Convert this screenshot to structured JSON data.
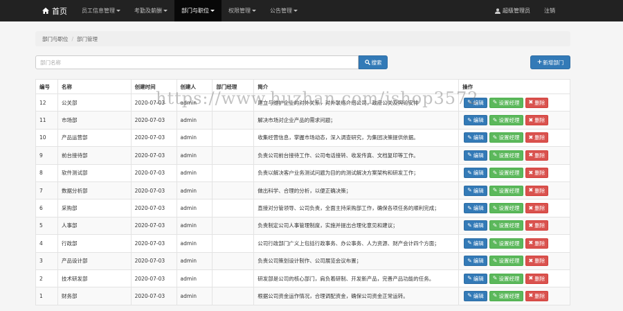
{
  "nav": {
    "brand": "首页",
    "items": [
      {
        "label": "员工信息管理",
        "active": false
      },
      {
        "label": "考勤及薪酬",
        "active": false
      },
      {
        "label": "部门与职位",
        "active": true
      },
      {
        "label": "权限管理",
        "active": false
      },
      {
        "label": "公告管理",
        "active": false
      }
    ],
    "user": "超级管理员",
    "logout": "注销"
  },
  "breadcrumb": {
    "parent": "部门与职位",
    "current": "部门管理"
  },
  "search": {
    "placeholder": "部门名称",
    "value": "",
    "button": "搜索"
  },
  "add_button": "新增部门",
  "table": {
    "headers": [
      "编号",
      "名称",
      "创建时间",
      "创建人",
      "部门经理",
      "简介",
      "操作"
    ],
    "rows": [
      {
        "id": "12",
        "name": "公关部",
        "date": "2020-07-03",
        "creator": "admin",
        "manager": "",
        "desc": "建立与维护企业的对外关系，对外联络介绍公司，政府公关及舆论安排"
      },
      {
        "id": "11",
        "name": "市场部",
        "date": "2020-07-03",
        "creator": "admin",
        "manager": "",
        "desc": "解决市场对企业产品的需求问题；"
      },
      {
        "id": "10",
        "name": "产品运营部",
        "date": "2020-07-03",
        "creator": "admin",
        "manager": "",
        "desc": "收集经营信息，掌握市场动态，深入调查研究，为集团决策提供依据。"
      },
      {
        "id": "9",
        "name": "前台接待部",
        "date": "2020-07-03",
        "creator": "admin",
        "manager": "",
        "desc": "负责公司前台接待工作、公司电话接转、收发传真、文档复印等工作。"
      },
      {
        "id": "8",
        "name": "软件测试部",
        "date": "2020-07-03",
        "creator": "admin",
        "manager": "",
        "desc": "负责以解决客户业务测试问题为目的的测试解决方案架构和研发工作；"
      },
      {
        "id": "7",
        "name": "数据分析部",
        "date": "2020-07-03",
        "creator": "admin",
        "manager": "",
        "desc": "做出科学、合理的分析，以便正确决策；"
      },
      {
        "id": "6",
        "name": "采购部",
        "date": "2020-07-03",
        "creator": "admin",
        "manager": "",
        "desc": "直接对分管领导、公司负责，全面主持采购部工作，确保各项任务的顺利完成；"
      },
      {
        "id": "5",
        "name": "人事部",
        "date": "2020-07-03",
        "creator": "admin",
        "manager": "",
        "desc": "负责制定公司人事管理制度，实施并提出合理化意见和建议；"
      },
      {
        "id": "4",
        "name": "行政部",
        "date": "2020-07-03",
        "creator": "admin",
        "manager": "",
        "desc": "公司行政部门广义上包括行政事务、办公事务、人力资源、财产会计四个方面；"
      },
      {
        "id": "3",
        "name": "产品设计部",
        "date": "2020-07-03",
        "creator": "admin",
        "manager": "",
        "desc": "负责公司策划设计制作、公司展览会议布置；"
      },
      {
        "id": "2",
        "name": "技术研发部",
        "date": "2020-07-03",
        "creator": "admin",
        "manager": "",
        "desc": "研发部是公司的核心部门，肩负着研制、开发新产品，完善产品功能的任务。"
      },
      {
        "id": "1",
        "name": "财务部",
        "date": "2020-07-03",
        "creator": "admin",
        "manager": "",
        "desc": "根据公司资金运作情况，合理调配资金，确保公司资金正常运转。"
      }
    ],
    "actions": {
      "edit": "编辑",
      "set_manager": "设置经理",
      "delete": "删除"
    }
  },
  "watermark": "https://www.huzhan.com/ishop3572",
  "colors": {
    "navbar": "#222222",
    "primary": "#337ab7",
    "success": "#5cb85c",
    "danger": "#d9534f"
  },
  "icons": {
    "brand": "home-icon",
    "user": "user-icon",
    "search": "search-icon",
    "add": "plus-icon",
    "edit": "pencil-icon",
    "set": "pencil-icon",
    "delete": "close-icon"
  }
}
